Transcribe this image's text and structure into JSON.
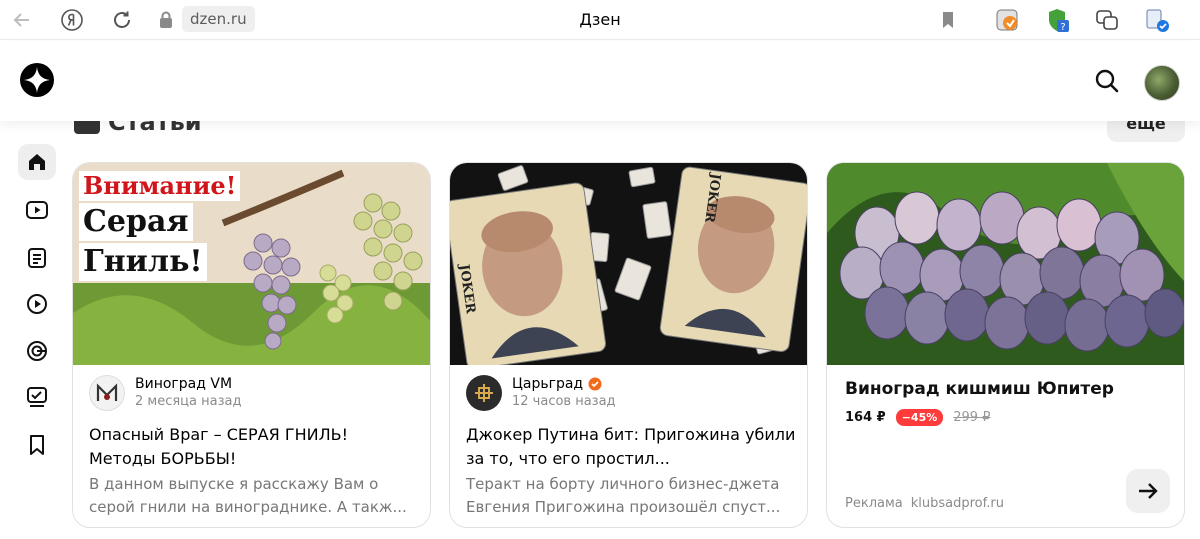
{
  "browser": {
    "url": "dzen.ru",
    "tab_title": "Дзен"
  },
  "section": {
    "title": "Статьи",
    "more_label": "еще"
  },
  "sidebar": {
    "items": [
      {
        "name": "home",
        "icon": "home-icon",
        "active": true
      },
      {
        "name": "video",
        "icon": "video-icon"
      },
      {
        "name": "articles",
        "icon": "article-icon"
      },
      {
        "name": "shorts",
        "icon": "shorts-icon"
      },
      {
        "name": "subscriptions",
        "icon": "subscriptions-icon"
      },
      {
        "name": "tasks",
        "icon": "checklist-icon"
      },
      {
        "name": "bookmarks",
        "icon": "bookmark-icon"
      }
    ]
  },
  "cards": [
    {
      "image_caption_lines": [
        "Внимание!",
        "Серая",
        "Гниль!"
      ],
      "source": "Виноград VM",
      "time": "2 месяца назад",
      "title": "Опасный Враг – СЕРАЯ ГНИЛЬ! Методы БОРЬБЫ!",
      "snippet": "В данном выпуске я расскажу Вам о серой гнили на винограднике. А такж..."
    },
    {
      "image_card_text": "JOKER",
      "source": "Царьград",
      "verified": true,
      "time": "12 часов назад",
      "title": "Джокер Путина бит: Пригожина убили за то, что его простил...",
      "snippet": "Теракт на борту личного бизнес-джета Евгения Пригожина произошёл спуст..."
    }
  ],
  "ad": {
    "title": "Виноград кишмиш Юпитер",
    "price": "164 ₽",
    "discount": "−45%",
    "old_price": "299 ₽",
    "label": "Реклама",
    "domain": "klubsadprof.ru"
  },
  "colors": {
    "accent_red": "#ff3b3b",
    "verified_orange": "#f26a1b",
    "caption_red": "#d0161b"
  }
}
